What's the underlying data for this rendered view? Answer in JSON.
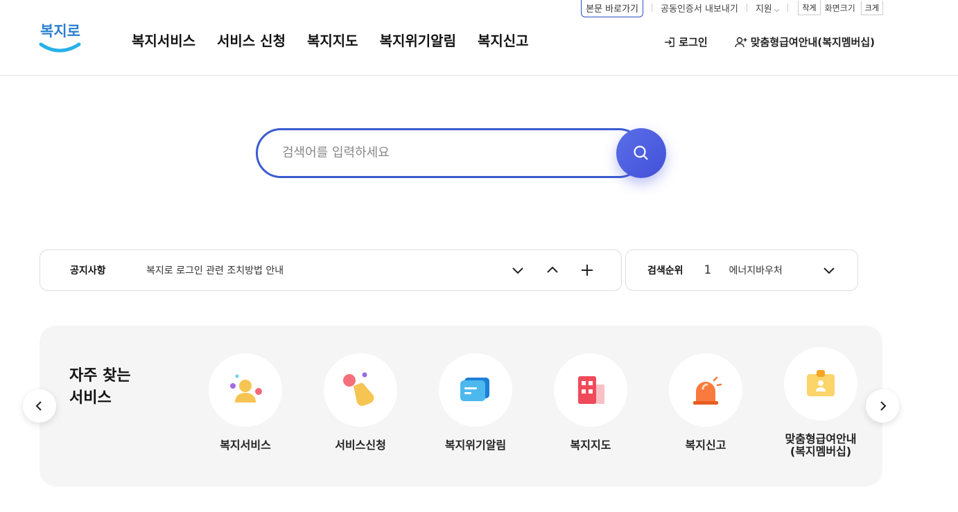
{
  "utility": {
    "skip_link": "본문 바로가기",
    "cert_export": "공동인증서 내보내기",
    "support": "지원",
    "size_small": "작게",
    "size_label": "화면크기",
    "size_large": "크게"
  },
  "logo": {
    "text": "복지로"
  },
  "nav": [
    "복지서비스",
    "서비스 신청",
    "복지지도",
    "복지위기알림",
    "복지신고"
  ],
  "header_right": {
    "login": "로그인",
    "membership": "맞춤형급여안내(복지멤버십)"
  },
  "search": {
    "placeholder": "검색어를 입력하세요"
  },
  "notice": {
    "label": "공지사항",
    "text": "복지로 로그인 관련 조치방법 안내"
  },
  "rank": {
    "label": "검색순위",
    "number": "1",
    "term": "에너지바우처"
  },
  "favorites": {
    "title_line1": "자주 찾는",
    "title_line2": "서비스",
    "items": [
      {
        "label": "복지서비스",
        "icon": "person-icon"
      },
      {
        "label": "서비스신청",
        "icon": "hand-tap-icon"
      },
      {
        "label": "복지위기알림",
        "icon": "message-icon"
      },
      {
        "label": "복지지도",
        "icon": "building-icon"
      },
      {
        "label": "복지신고",
        "icon": "siren-icon"
      },
      {
        "label": "맞춤형급여안내\n(복지멤버십)",
        "icon": "id-card-icon"
      }
    ]
  },
  "colors": {
    "accent": "#3b5bd0",
    "logo": "#2a7fd1"
  }
}
